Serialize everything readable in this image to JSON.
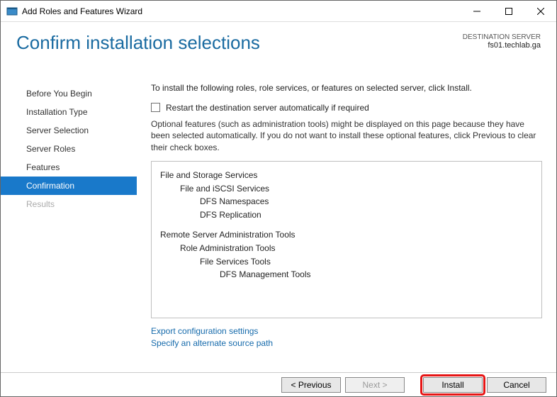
{
  "titlebar": {
    "title": "Add Roles and Features Wizard"
  },
  "header": {
    "page_title": "Confirm installation selections",
    "dest_label": "DESTINATION SERVER",
    "dest_value": "fs01.techlab.ga"
  },
  "sidebar": {
    "items": [
      {
        "label": "Before You Begin",
        "active": false,
        "disabled": false
      },
      {
        "label": "Installation Type",
        "active": false,
        "disabled": false
      },
      {
        "label": "Server Selection",
        "active": false,
        "disabled": false
      },
      {
        "label": "Server Roles",
        "active": false,
        "disabled": false
      },
      {
        "label": "Features",
        "active": false,
        "disabled": false
      },
      {
        "label": "Confirmation",
        "active": true,
        "disabled": false
      },
      {
        "label": "Results",
        "active": false,
        "disabled": true
      }
    ]
  },
  "content": {
    "intro": "To install the following roles, role services, or features on selected server, click Install.",
    "restart_label": "Restart the destination server automatically if required",
    "optional_text": "Optional features (such as administration tools) might be displayed on this page because they have been selected automatically. If you do not want to install these optional features, click Previous to clear their check boxes.",
    "tree": [
      {
        "level": 0,
        "text": "File and Storage Services"
      },
      {
        "level": 1,
        "text": "File and iSCSI Services"
      },
      {
        "level": 2,
        "text": "DFS Namespaces"
      },
      {
        "level": 2,
        "text": "DFS Replication"
      },
      {
        "gap": true
      },
      {
        "level": 0,
        "text": "Remote Server Administration Tools"
      },
      {
        "level": 1,
        "text": "Role Administration Tools"
      },
      {
        "level": 2,
        "text": "File Services Tools"
      },
      {
        "level": 3,
        "text": "DFS Management Tools"
      }
    ],
    "link_export": "Export configuration settings",
    "link_altpath": "Specify an alternate source path"
  },
  "footer": {
    "previous": "< Previous",
    "next": "Next >",
    "install": "Install",
    "cancel": "Cancel"
  }
}
